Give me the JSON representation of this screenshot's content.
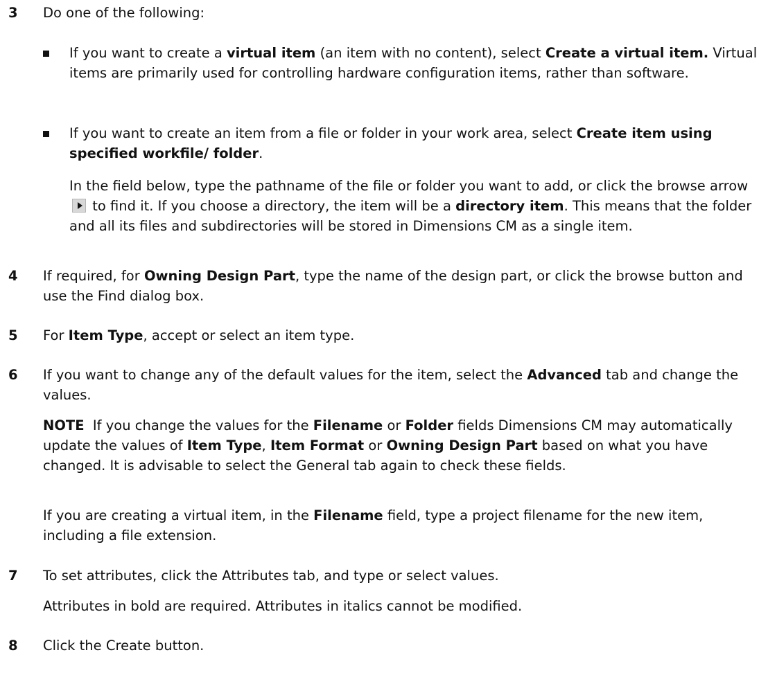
{
  "steps": {
    "s3": {
      "num": "3",
      "intro": "Do one of the following:",
      "bullet1": {
        "t1": "If you want to create a ",
        "b1": "virtual item",
        "t2": " (an item with no content), select ",
        "b2": "Create a virtual item.",
        "t3": " Virtual items are primarily used for controlling hardware configuration items, rather than software."
      },
      "bullet2": {
        "t1": "If you want to create an item from a file or folder in your work area, select ",
        "b1": "Create item using specified workfile/ folder",
        "t2": "."
      },
      "para": {
        "t1": "In the field below, type the pathname of the file or folder you want to add, or click the browse arrow",
        "t2": " to find it. If you choose a directory, the item will be a ",
        "b1": "directory item",
        "t3": ". This means that the folder and all its files and subdirectories will be stored in Dimensions CM as a single item."
      }
    },
    "s4": {
      "num": "4",
      "t1": "If required, for ",
      "b1": "Owning Design Part",
      "t2": ", type the name of the design part, or click the browse button and use the Find dialog box."
    },
    "s5": {
      "num": "5",
      "t1": "For ",
      "b1": "Item Type",
      "t2": ", accept or select an item type."
    },
    "s6": {
      "num": "6",
      "t1": "If you want to change any of the default values for the item, select the ",
      "b1": "Advanced",
      "t2": " tab and change the values.",
      "note": {
        "label": "NOTE",
        "t1": "  If you change the values for the ",
        "b1": "Filename",
        "t2": " or ",
        "b2": "Folder",
        "t3": " fields Dimensions CM may automatically update the values of ",
        "b3": "Item Type",
        "t4": ", ",
        "b4": "Item Format",
        "t5": " or ",
        "b5": "Owning Design Part",
        "t6": " based on what you have changed. It is advisable to select the General tab again to check these fields."
      },
      "virtual": {
        "t1": "If you are creating a virtual item, in the ",
        "b1": "Filename",
        "t2": " field, type a project filename for the new item, including a file extension."
      }
    },
    "s7": {
      "num": "7",
      "text": "To set attributes, click the Attributes tab, and type or select values.",
      "sub": "Attributes in bold are required. Attributes in italics cannot be modified."
    },
    "s8": {
      "num": "8",
      "text": "Click the Create button."
    }
  },
  "icons": {
    "browse_arrow": "browse-arrow-icon",
    "bullet": "square-bullet"
  }
}
